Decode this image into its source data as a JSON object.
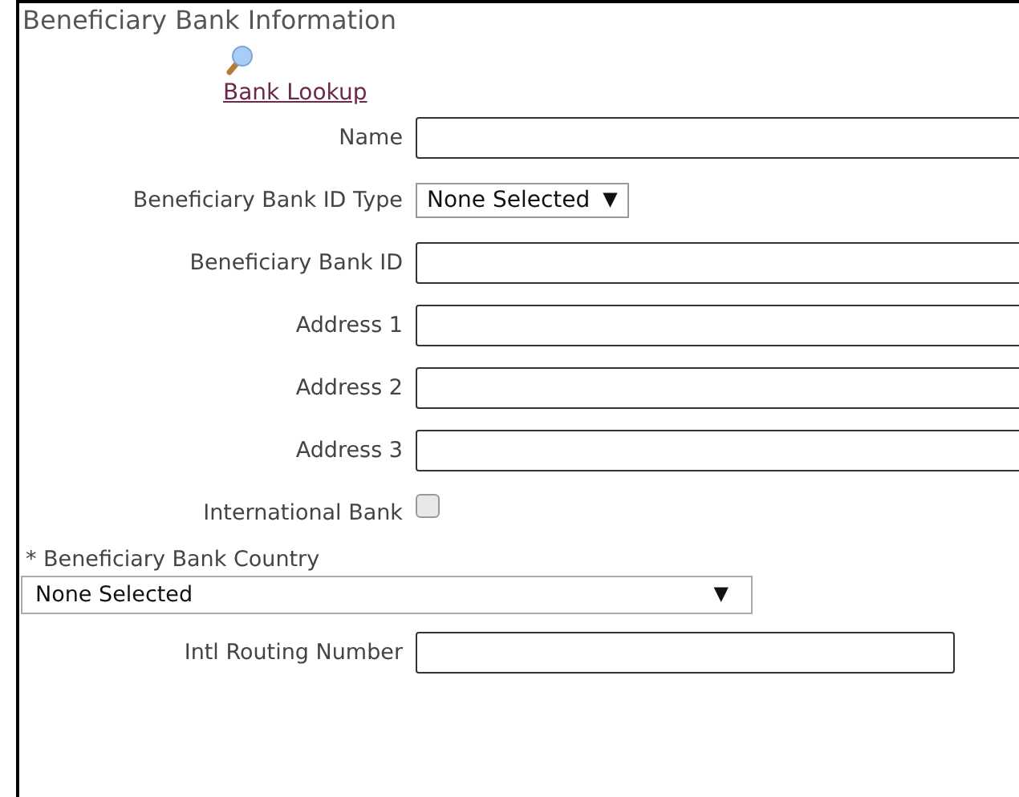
{
  "section_title": "Beneficiary Bank Information",
  "lookup": {
    "label": "Bank Lookup"
  },
  "fields": [
    {
      "kind": "text",
      "label": "Name"
    },
    {
      "kind": "select",
      "label": "Beneficiary Bank ID Type",
      "value": "None Selected",
      "arrow": "▼"
    },
    {
      "kind": "text",
      "label": "Beneficiary Bank ID"
    },
    {
      "kind": "text",
      "label": "Address 1"
    },
    {
      "kind": "text",
      "label": "Address 2"
    },
    {
      "kind": "text",
      "label": "Address 3"
    },
    {
      "kind": "checkbox",
      "label": "International Bank",
      "checked": false
    },
    {
      "kind": "wide_select",
      "required_mark": "*",
      "label": "Beneficiary Bank Country",
      "value": "None Selected",
      "arrow": "▼"
    },
    {
      "kind": "short",
      "label": "Intl Routing Number"
    }
  ]
}
